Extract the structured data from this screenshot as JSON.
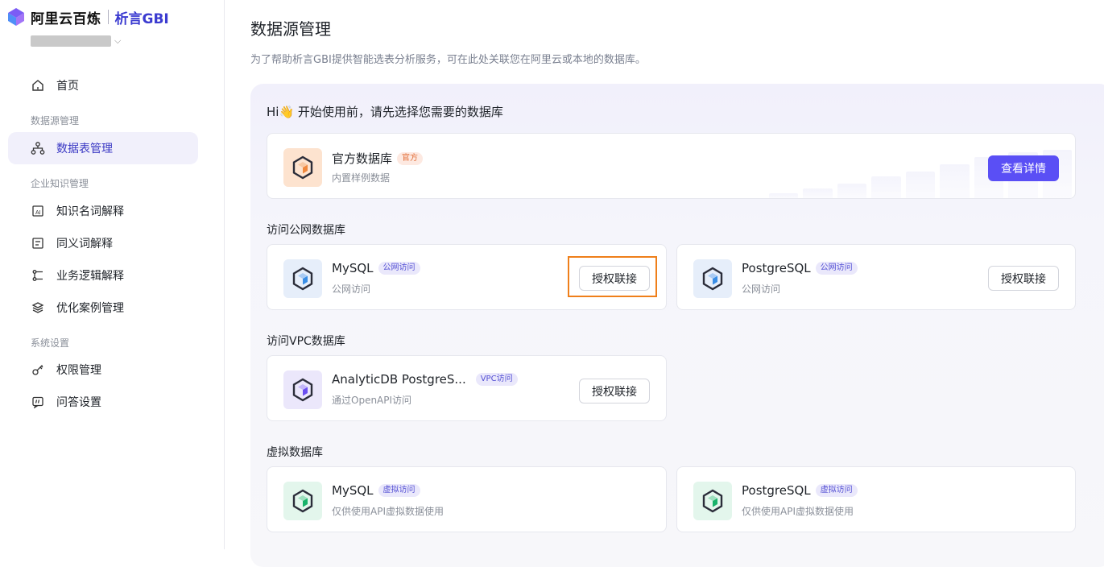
{
  "brand": {
    "name": "阿里云百炼",
    "product": "析言GBI"
  },
  "sidebar": {
    "items": [
      {
        "label": "首页",
        "icon": "home-icon"
      },
      {
        "label": "数据表管理",
        "icon": "hierarchy-icon",
        "active": true
      },
      {
        "label": "知识名词解释",
        "icon": "ai-doc-icon"
      },
      {
        "label": "同义词解释",
        "icon": "list-doc-icon"
      },
      {
        "label": "业务逻辑解释",
        "icon": "flow-icon"
      },
      {
        "label": "优化案例管理",
        "icon": "layers-icon"
      },
      {
        "label": "权限管理",
        "icon": "key-icon"
      },
      {
        "label": "问答设置",
        "icon": "chat-setting-icon"
      }
    ],
    "sections": [
      "数据源管理",
      "企业知识管理",
      "系统设置"
    ]
  },
  "main": {
    "title": "数据源管理",
    "subtitle": "为了帮助析言GBI提供智能选表分析服务，可在此处关联您在阿里云或本地的数据库。",
    "greeting": "Hi👋 开始使用前，请先选择您需要的数据库",
    "official": {
      "title": "官方数据库",
      "tag": "官方",
      "desc": "内置样例数据",
      "button": "查看详情"
    },
    "public_section": "访问公网数据库",
    "public": [
      {
        "title": "MySQL",
        "tag": "公网访问",
        "desc": "公网访问",
        "button": "授权联接"
      },
      {
        "title": "PostgreSQL",
        "tag": "公网访问",
        "desc": "公网访问",
        "button": "授权联接"
      }
    ],
    "vpc_section": "访问VPC数据库",
    "vpc": [
      {
        "title": "AnalyticDB PostgreS...",
        "tag": "VPC访问",
        "desc": "通过OpenAPI访问",
        "button": "授权联接"
      }
    ],
    "virtual_section": "虚拟数据库",
    "virtual": [
      {
        "title": "MySQL",
        "tag": "虚拟访问",
        "desc": "仅供使用API虚拟数据使用"
      },
      {
        "title": "PostgreSQL",
        "tag": "虚拟访问",
        "desc": "仅供使用API虚拟数据使用"
      }
    ]
  },
  "colors": {
    "accent": "#5a4ff5",
    "highlight": "#ef7f1a",
    "mysql_blue": "#3a8ee6",
    "vpc_purple": "#6b4ff0",
    "virtual_green": "#19b36b",
    "official_orange": "#f0883e"
  }
}
